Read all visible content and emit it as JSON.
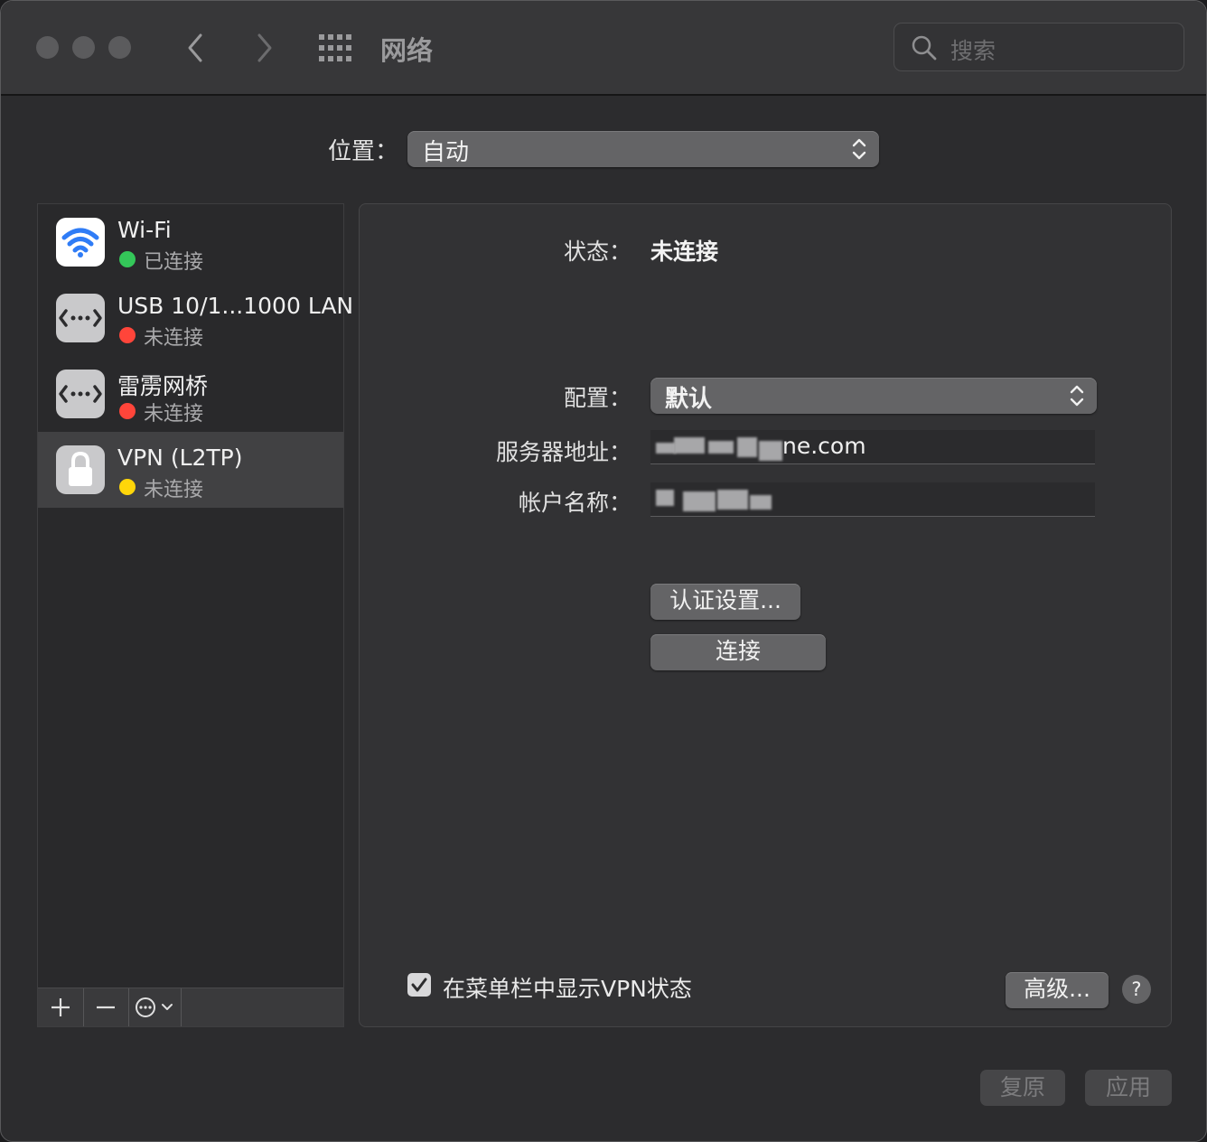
{
  "window": {
    "title": "网络",
    "search_placeholder": "搜索"
  },
  "location": {
    "label": "位置：",
    "value": "自动"
  },
  "services": [
    {
      "name": "Wi-Fi",
      "status": "已连接",
      "status_color": "#34c759",
      "icon": "wifi-icon"
    },
    {
      "name": "USB 10/1...1000 LAN",
      "status": "未连接",
      "status_color": "#ff453a",
      "icon": "ethernet-icon"
    },
    {
      "name": "雷雳网桥",
      "status": "未连接",
      "status_color": "#ff453a",
      "icon": "ethernet-icon"
    },
    {
      "name": "VPN (L2TP)",
      "status": "未连接",
      "status_color": "#ffd60a",
      "icon": "lock-icon"
    }
  ],
  "detail": {
    "status_label": "状态：",
    "status_value": "未连接",
    "config_label": "配置：",
    "config_value": "默认",
    "server_label": "服务器地址：",
    "server_value": "ne.com",
    "account_label": "帐户名称：",
    "auth_button": "认证设置...",
    "connect_button": "连接",
    "show_vpn_status_label": "在菜单栏中显示VPN状态",
    "show_vpn_status_checked": true,
    "advanced_button": "高级...",
    "help_button": "?"
  },
  "footer": {
    "revert_button": "复原",
    "apply_button": "应用"
  }
}
